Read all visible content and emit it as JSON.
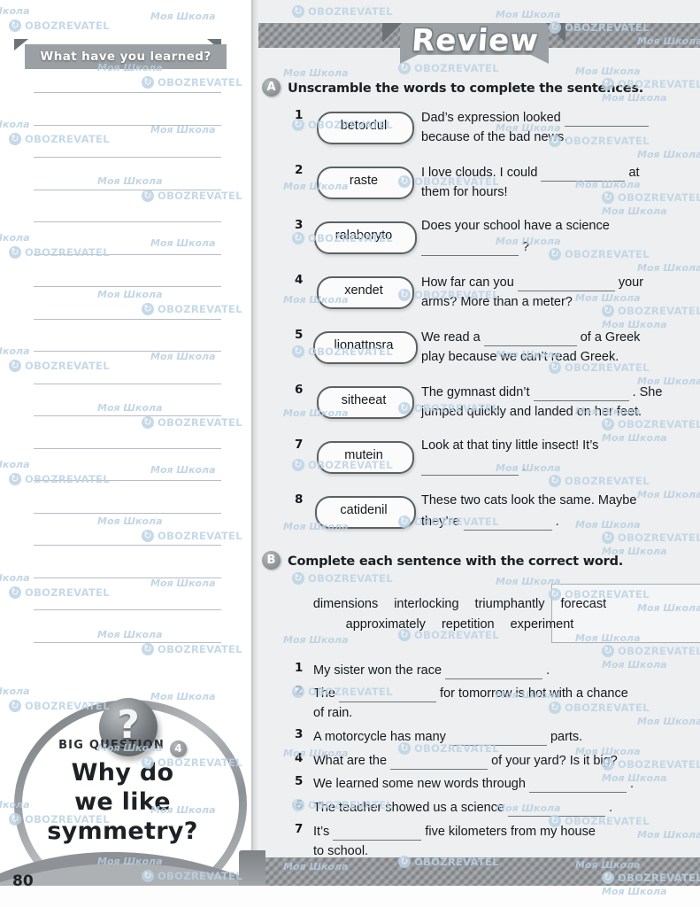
{
  "left_page": {
    "banner_title": "What have you learned?",
    "writing_lines_count": 18,
    "big_question": {
      "label": "BIG QUESTION",
      "number": "4",
      "question_line1": "Why do",
      "question_line2": "we like",
      "question_line3": "symmetry?",
      "icon": "question-mark-icon"
    },
    "page_number": "80"
  },
  "right_page": {
    "header_title": "Review",
    "section_a": {
      "badge": "A",
      "instruction": "Unscramble the words to complete the sentences.",
      "items": [
        {
          "num": "1",
          "scrambled": "betordul",
          "line1_pre": "Dad’s expression looked ",
          "line1_blank": 95,
          "line1_post": "",
          "line2": "because of the bad news."
        },
        {
          "num": "2",
          "scrambled": "raste",
          "line1_pre": "I love clouds. I could ",
          "line1_blank": 95,
          "line1_post": " at",
          "line2": "them for hours!"
        },
        {
          "num": "3",
          "scrambled": "ralaboryto",
          "line1_pre": "Does your school have a science",
          "line1_blank": 0,
          "line1_post": "",
          "line2_blank": 110,
          "line2_post": " ?"
        },
        {
          "num": "4",
          "scrambled": "xendet",
          "line1_pre": "How far can you ",
          "line1_blank": 110,
          "line1_post": " your",
          "line2": "arms? More than a meter?"
        },
        {
          "num": "5",
          "scrambled": "lionattnsra",
          "line1_pre": "We read a ",
          "line1_blank": 105,
          "line1_post": " of a Greek",
          "line2": "play because we can’t read Greek."
        },
        {
          "num": "6",
          "scrambled": "sitheeat",
          "line1_pre": "The gymnast didn’t ",
          "line1_blank": 108,
          "line1_post": " . She",
          "line2": "jumped quickly and landed on her feet."
        },
        {
          "num": "7",
          "scrambled": "mutein",
          "line1_pre": "Look at that tiny little insect! It’s",
          "line1_blank": 0,
          "line1_post": "",
          "line2_blank": 110,
          "line2_post": " ."
        },
        {
          "num": "8",
          "scrambled": "catidenil",
          "line1_pre": "These two cats look the same. Maybe",
          "line1_blank": 0,
          "line1_post": "",
          "line2_pre": "they’re ",
          "line2_blank": 100,
          "line2_post": " ."
        }
      ]
    },
    "section_b": {
      "badge": "B",
      "instruction": "Complete each sentence with the correct word.",
      "word_bank_row1": [
        "dimensions",
        "interlocking",
        "triumphantly",
        "forecast"
      ],
      "word_bank_row2": [
        "approximately",
        "repetition",
        "experiment"
      ],
      "items": [
        {
          "num": "1",
          "pre": "My sister won the race ",
          "blank": 110,
          "post": " ."
        },
        {
          "num": "2",
          "pre": "The ",
          "blank": 110,
          "post": " for tomorrow is hot with a chance",
          "line2": "of rain."
        },
        {
          "num": "3",
          "pre": "A motorcycle has many ",
          "blank": 110,
          "post": " parts."
        },
        {
          "num": "4",
          "pre": "What are the ",
          "blank": 110,
          "post": " of your yard? Is it big?"
        },
        {
          "num": "5",
          "pre": "We learned some new words through ",
          "blank": 110,
          "post": " ."
        },
        {
          "num": "6",
          "pre": "The teacher showed us a science ",
          "blank": 110,
          "post": " ."
        },
        {
          "num": "7",
          "pre": "It’s ",
          "blank": 100,
          "post": " five kilometers from my house",
          "line2": "to school."
        }
      ]
    }
  },
  "watermarks": {
    "brand_cyrillic": "Моя Школа",
    "brand_latin": "OBOZREVATEL",
    "icon": "refresh-circle-icon"
  },
  "colors": {
    "page_bg": "#edeff0",
    "left_page_bg": "#ffffff",
    "band_gray": "#8e9296",
    "ribbon_gray": "#9ba0a4",
    "text_dark": "#15191d",
    "rule_line": "#b8bdc1",
    "watermark_blue": "#bcd3e4"
  }
}
